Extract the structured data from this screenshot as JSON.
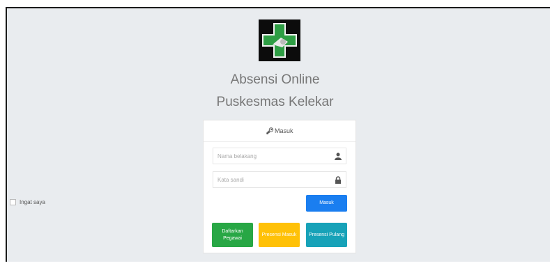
{
  "app": {
    "title_line1": "Absensi Online",
    "title_line2": "Puskesmas Kelekar"
  },
  "login": {
    "header": "Masuk",
    "username_placeholder": "Nama belakang",
    "password_placeholder": "Kata sandi",
    "remember_label": "Ingat saya",
    "submit_label": "Masuk"
  },
  "actions": {
    "register_label": "Daftarkan Pegawai",
    "checkin_label": "Presensi Masuk",
    "checkout_label": "Presensi Pulang"
  },
  "colors": {
    "page_bg": "#e9ecef",
    "primary": "#1a7ef0",
    "success": "#28a745",
    "warning": "#ffc107",
    "info": "#17a2b8",
    "logo_cross": "#2e9e44"
  }
}
